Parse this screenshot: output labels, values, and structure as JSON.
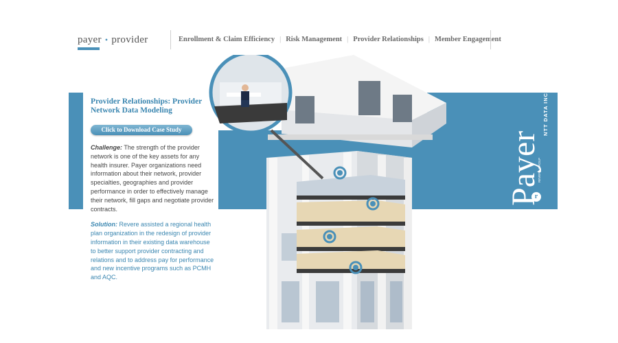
{
  "brand": {
    "left": "payer",
    "dot": "•",
    "right": "provider"
  },
  "nav": {
    "items": [
      "Enrollment & Claim Efficiency",
      "Risk Management",
      "Provider Relationships",
      "Member Engagement"
    ],
    "separator": "|"
  },
  "panel": {
    "title": "Provider Relationships: Provider Network Data Modeling",
    "download_label": "Click to Download Case Study",
    "challenge_label": "Challenge:",
    "challenge_text": " The strength of the provider network is one of the key assets for any health insurer. Payer organizations need information about their network, provider specialties, geographies and provider performance in order to effectively manage their network, fill gaps and negotiate provider contracts.",
    "solution_label": "Solution:",
    "solution_text": " Revere assisted a regional health plan organization in the redesign of provider information in their existing data warehouse to better support provider contracting and relations and to address pay for performance and new incentive programs such as PCMH and AQC."
  },
  "side": {
    "heading": "Payer",
    "ntt_text": "NTT DATA INC.",
    "revere_mark": "r",
    "revere_text": "REVERE GROUP"
  },
  "colors": {
    "accent": "#4a90b8"
  }
}
